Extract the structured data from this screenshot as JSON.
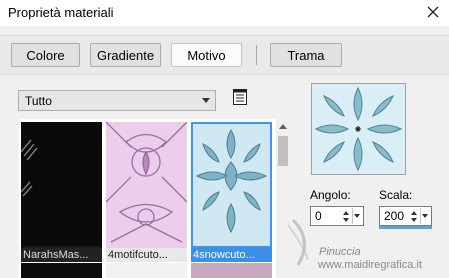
{
  "window": {
    "title": "Proprietà materiali"
  },
  "tabs": [
    {
      "label": "Colore"
    },
    {
      "label": "Gradiente"
    },
    {
      "label": "Motivo",
      "active": true
    },
    {
      "label": "Trama"
    }
  ],
  "category": {
    "selected": "Tutto"
  },
  "thumbnails": [
    {
      "label": "NarahsMas..."
    },
    {
      "label": "4motifcuto..."
    },
    {
      "label": "4snowcuto...",
      "selected": true
    }
  ],
  "fields": {
    "angle": {
      "label": "Angolo:",
      "value": "0"
    },
    "scale": {
      "label": "Scala:",
      "value": "200"
    }
  },
  "watermark": {
    "line1": "Pinuccia",
    "line2": "www.maidiregrafica.it"
  },
  "colors": {
    "accent": "#3a96f0",
    "selected_bg": "#3c8fe6"
  }
}
